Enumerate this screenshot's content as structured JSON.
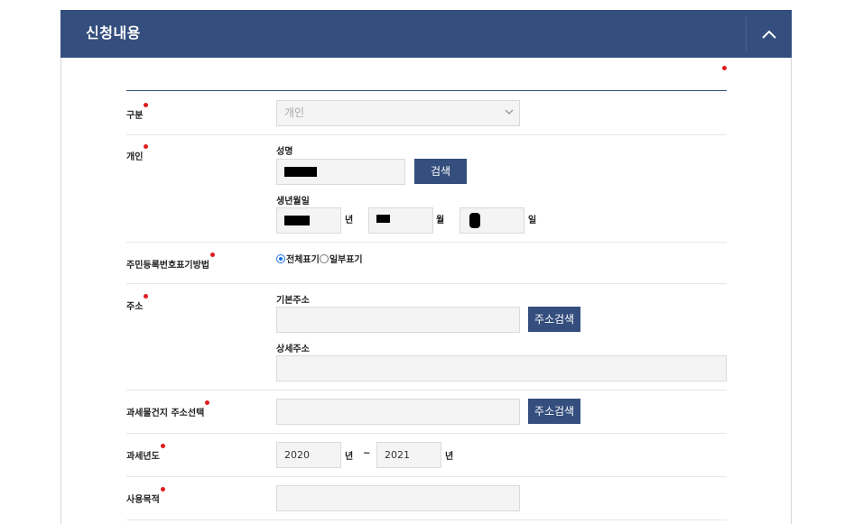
{
  "header": {
    "title": "신청내용",
    "collapse_icon": "chevron-up-icon"
  },
  "colors": {
    "header_bg": "#344e7d",
    "required_dot": "#e01b1b",
    "button_bg": "#344e7d"
  },
  "form": {
    "type": {
      "label": "구분",
      "selected": "개인"
    },
    "individual": {
      "label": "개인",
      "name_label": "성명",
      "name_value": "",
      "search_button": "검색",
      "birth_label": "생년월일",
      "birth_year_value": "",
      "birth_month_value": "",
      "birth_day_value": "",
      "year_unit": "년",
      "month_unit": "월",
      "day_unit": "일"
    },
    "resident_display": {
      "label": "주민등록번호표기방법",
      "options": [
        "전체표기",
        "일부표기"
      ],
      "selected_index": 0
    },
    "address": {
      "label": "주소",
      "basic_label": "기본주소",
      "basic_value": "",
      "search_button": "주소검색",
      "detail_label": "상세주소",
      "detail_value": ""
    },
    "tax_address": {
      "label": "과세물건지 주소선택",
      "value": "",
      "search_button": "주소검색"
    },
    "tax_year": {
      "label": "과세년도",
      "from_value": "2020",
      "to_value": "2021",
      "unit": "년",
      "separator": "~"
    },
    "purpose": {
      "label": "사용목적",
      "value": ""
    }
  }
}
